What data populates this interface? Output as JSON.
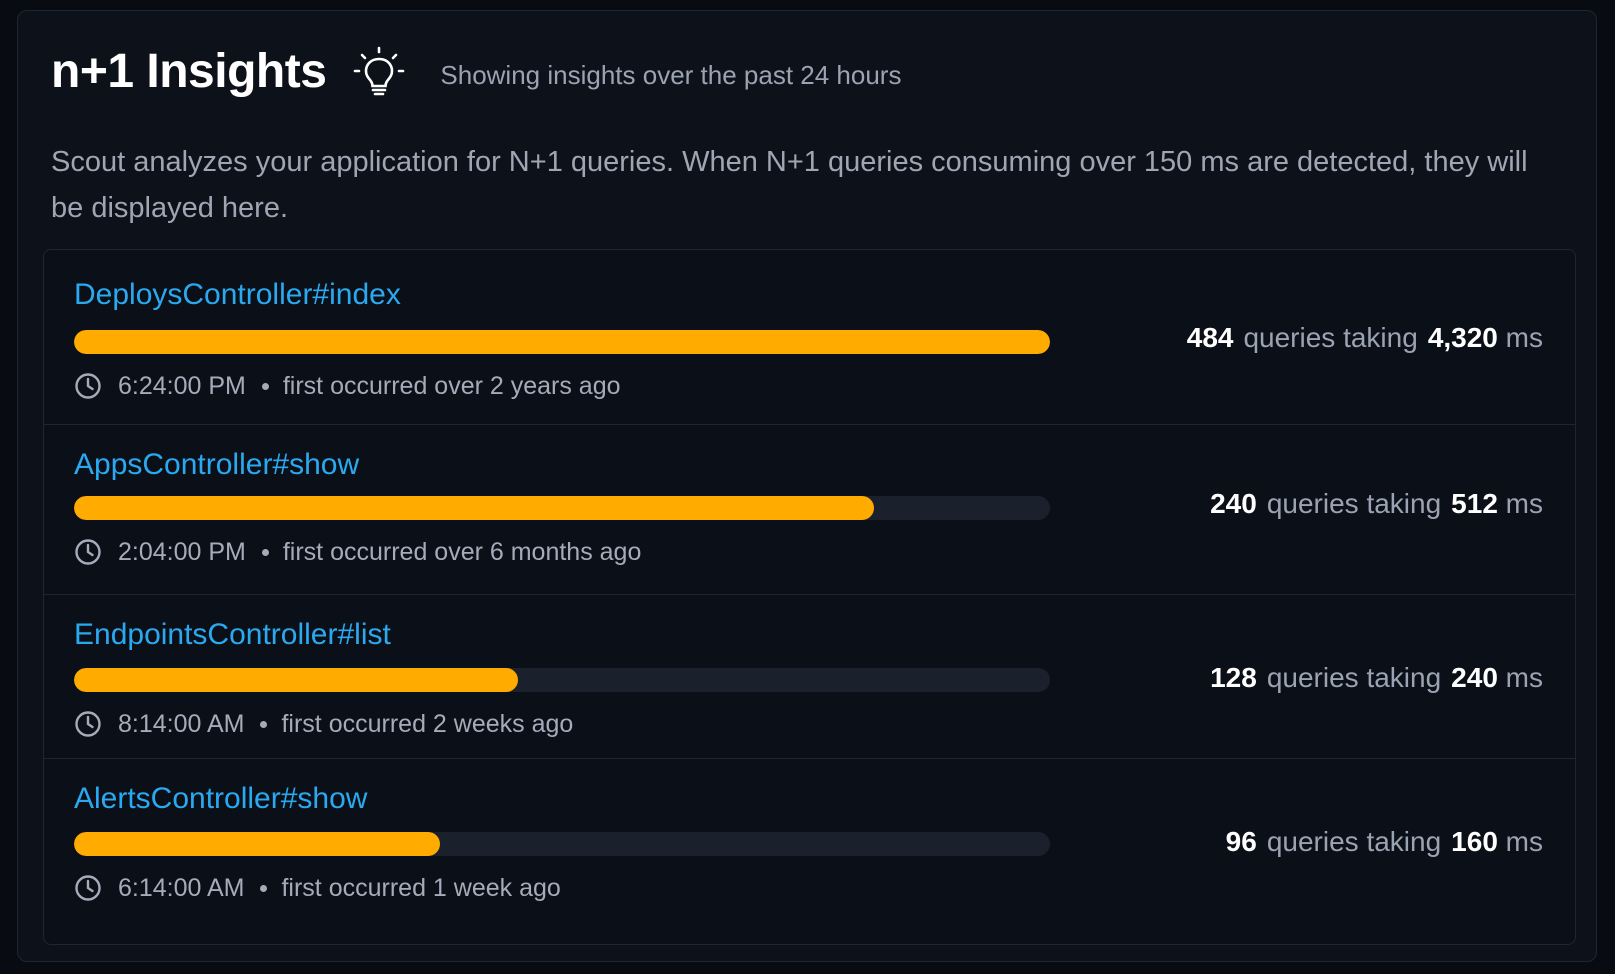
{
  "header": {
    "title": "n+1 Insights",
    "subtitle": "Showing insights over the past 24 hours",
    "icon": "lightbulb-icon"
  },
  "description": "Scout analyzes your application for N+1 queries. When N+1 queries consuming over 150 ms are detected, they will be displayed here.",
  "colors": {
    "accent": "#2aa9f0",
    "bar": "#ffab00",
    "track": "#1b212c",
    "background": "#0d1119"
  },
  "insights": [
    {
      "name": "DeploysController#index",
      "progress": 1.0,
      "time": "6:24:00 PM",
      "first_occurred": "first occurred over 2 years ago",
      "queries": "484",
      "queries_label": "queries taking",
      "duration": "4,320",
      "unit": "ms"
    },
    {
      "name": "AppsController#show",
      "progress": 0.82,
      "time": "2:04:00 PM",
      "first_occurred": "first occurred over 6 months ago",
      "queries": "240",
      "queries_label": "queries taking",
      "duration": "512",
      "unit": "ms"
    },
    {
      "name": "EndpointsController#list",
      "progress": 0.455,
      "time": "8:14:00 AM",
      "first_occurred": "first occurred 2 weeks ago",
      "queries": "128",
      "queries_label": "queries taking",
      "duration": "240",
      "unit": "ms"
    },
    {
      "name": "AlertsController#show",
      "progress": 0.375,
      "time": "6:14:00 AM",
      "first_occurred": "first occurred 1 week ago",
      "queries": "96",
      "queries_label": "queries taking",
      "duration": "160",
      "unit": "ms"
    }
  ]
}
